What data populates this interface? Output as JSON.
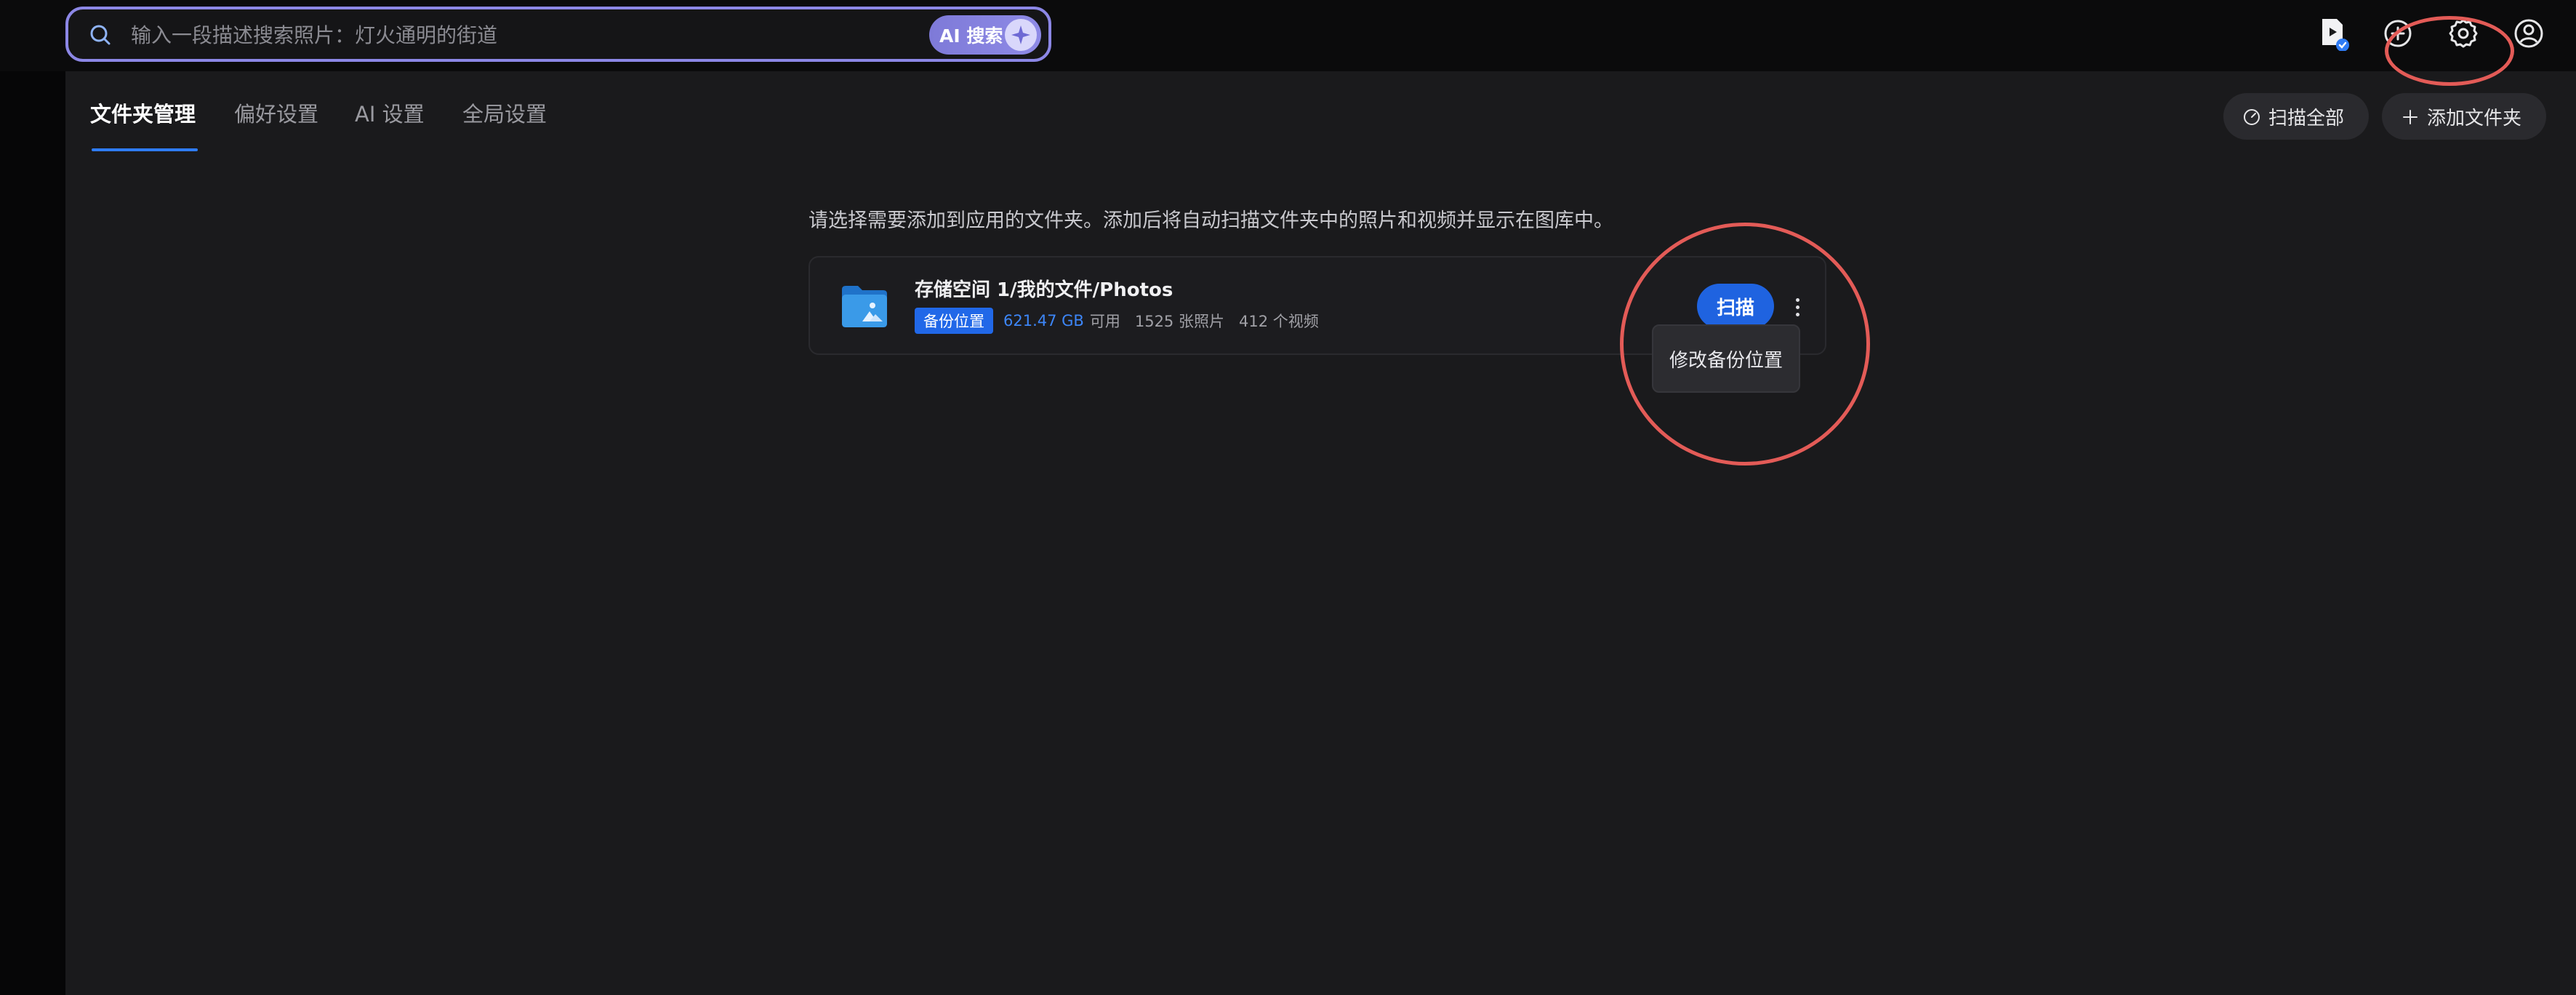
{
  "search": {
    "placeholder": "输入一段描述搜索照片：灯火通明的街道",
    "ai_button_label": "AI 搜索",
    "icon": "search-icon"
  },
  "topbar_icons": [
    "video-status-icon",
    "plus-circle-icon",
    "gear-icon",
    "user-icon"
  ],
  "tabs": [
    {
      "label": "文件夹管理",
      "active": true
    },
    {
      "label": "偏好设置",
      "active": false
    },
    {
      "label": "AI 设置",
      "active": false
    },
    {
      "label": "全局设置",
      "active": false
    }
  ],
  "actions": {
    "scan_all_label": "扫描全部",
    "add_folder_label": "添加文件夹"
  },
  "intro_text": "请选择需要添加到应用的文件夹。添加后将自动扫描文件夹中的照片和视频并显示在图库中。",
  "folder": {
    "path": "存储空间 1/我的文件/Photos",
    "badge": "备份位置",
    "capacity": "621.47 GB",
    "available_label": "可用",
    "photos": "1525 张照片",
    "videos": "412 个视频",
    "scan_label": "扫描"
  },
  "context_menu": {
    "item": "修改备份位置"
  },
  "colors": {
    "accent": "#2f7cf6",
    "search_border": "#8c87e6",
    "annotation": "#e35b57",
    "panel_bg": "#1a1a1c"
  }
}
